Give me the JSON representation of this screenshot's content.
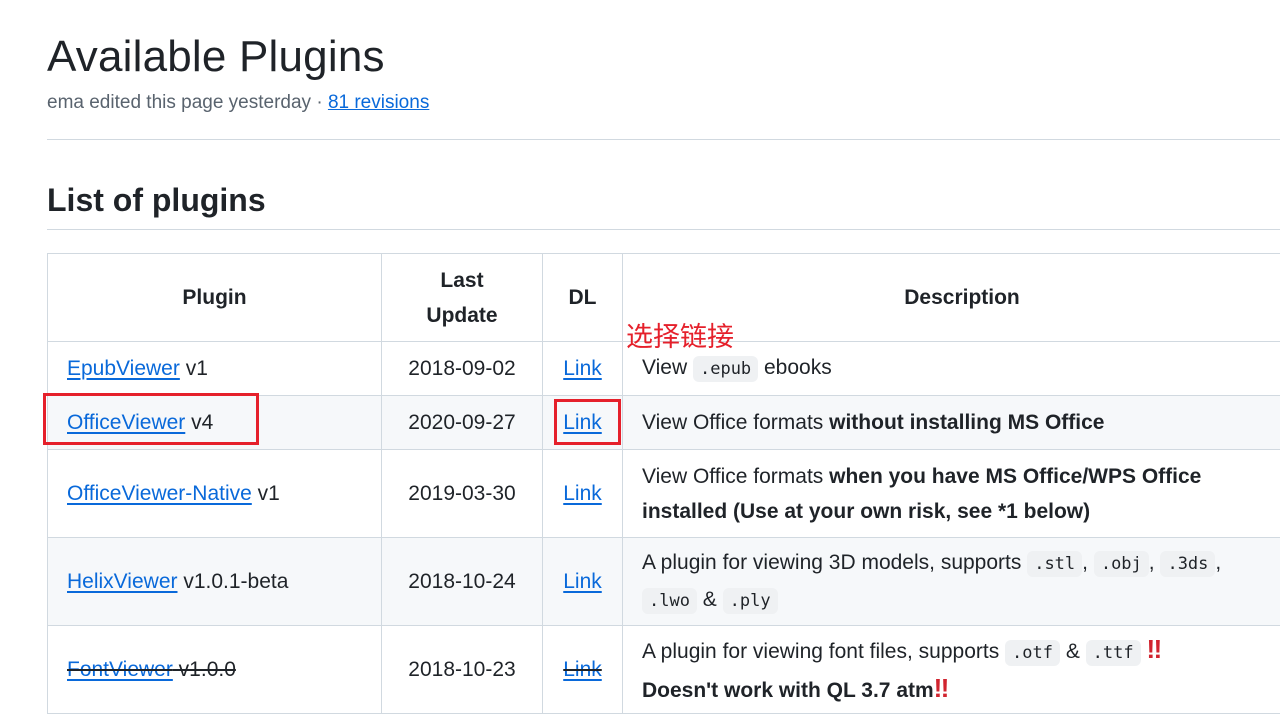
{
  "page": {
    "title": "Available Plugins",
    "meta_text": "ema edited this page yesterday · ",
    "revisions_link": "81 revisions",
    "section_heading": "List of plugins"
  },
  "table": {
    "headers": {
      "plugin": "Plugin",
      "last_update_1": "Last",
      "last_update_2": "Update",
      "dl": "DL",
      "description": "Description"
    },
    "rows": [
      {
        "name": "EpubViewer",
        "version": " v1",
        "date": "2018-09-02",
        "dl": "Link",
        "desc": {
          "pre": "View ",
          "code1": ".epub",
          "post": " ebooks"
        }
      },
      {
        "name": "OfficeViewer",
        "version": " v4",
        "date": "2020-09-27",
        "dl": "Link",
        "desc": {
          "pre": "View Office formats ",
          "bold": "without installing MS Office"
        }
      },
      {
        "name": "OfficeViewer-Native",
        "version": " v1",
        "date": "2019-03-30",
        "dl": "Link",
        "desc": {
          "pre": "View Office formats ",
          "bold": "when you have MS Office/WPS Office installed (Use at your own risk, see *1 below)"
        }
      },
      {
        "name": "HelixViewer",
        "version": " v1.0.1-beta",
        "date": "2018-10-24",
        "dl": "Link",
        "desc": {
          "pre": "A plugin for viewing 3D models, supports ",
          "codes": [
            ".stl",
            ".obj",
            ".3ds",
            ".lwo",
            ".ply"
          ],
          "sep1": ", ",
          "sep2": ", ",
          "sep3": ", ",
          "amp": " & "
        }
      },
      {
        "name": "FontViewer",
        "version": " v1.0.0",
        "date": "2018-10-23",
        "dl": "Link",
        "desc": {
          "pre": "A plugin for viewing font files, supports ",
          "code1": ".otf",
          "amp": " & ",
          "code2": ".ttf",
          "bang": "‼",
          "bold": "Doesn't work with QL 3.7 atm",
          "bang2": "‼"
        }
      }
    ]
  },
  "annotation": {
    "text": "选择链接",
    "color": "#e5202b"
  },
  "colors": {
    "link": "#0969da",
    "border": "#d1d9e0",
    "stripe": "#f6f8fa"
  }
}
